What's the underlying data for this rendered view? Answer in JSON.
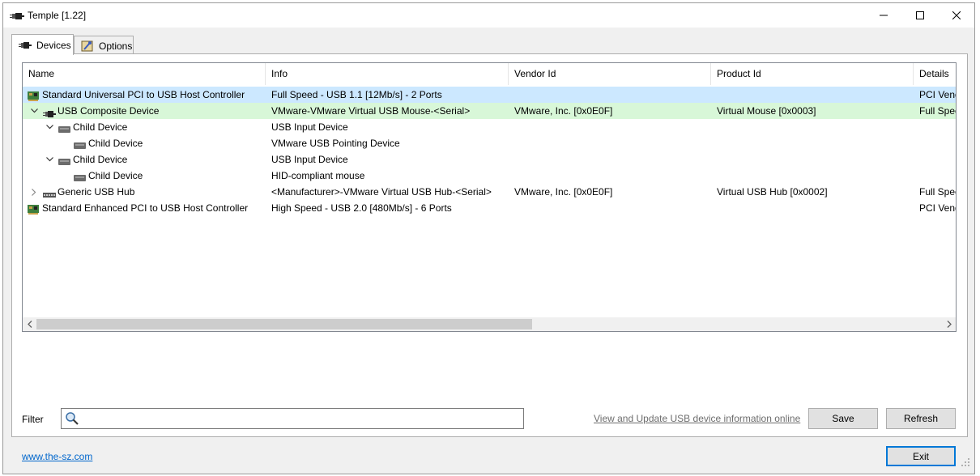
{
  "window": {
    "title": "Temple [1.22]"
  },
  "tabs": [
    {
      "label": "Devices",
      "icon": "usb-plug-icon",
      "active": true
    },
    {
      "label": "Options",
      "icon": "options-icon",
      "active": false
    }
  ],
  "columns": [
    "Name",
    "Info",
    "Vendor Id",
    "Product Id",
    "Details"
  ],
  "rows": [
    {
      "name": "Standard Universal PCI to USB Host Controller",
      "info": "Full Speed - USB 1.1 [12Mb/s] - 2 Ports",
      "vendor": "",
      "product": "",
      "details": "PCI Vendor",
      "level": 0,
      "expander": "none",
      "icon": "pci-card-icon",
      "highlight": "selected"
    },
    {
      "name": "USB Composite Device",
      "info": "VMware-VMware Virtual USB Mouse-<Serial>",
      "vendor": "VMware, Inc. [0x0E0F]",
      "product": "Virtual Mouse [0x0003]",
      "details": "Full Speed",
      "level": 1,
      "expander": "expanded",
      "icon": "usb-plug-icon",
      "highlight": "green"
    },
    {
      "name": "Child Device",
      "info": "USB Input Device",
      "vendor": "",
      "product": "",
      "details": "",
      "level": 2,
      "expander": "expanded",
      "icon": "device-icon",
      "highlight": ""
    },
    {
      "name": "Child Device",
      "info": "VMware USB Pointing Device",
      "vendor": "",
      "product": "",
      "details": "",
      "level": 3,
      "expander": "none",
      "icon": "device-icon",
      "highlight": ""
    },
    {
      "name": "Child Device",
      "info": "USB Input Device",
      "vendor": "",
      "product": "",
      "details": "",
      "level": 2,
      "expander": "expanded",
      "icon": "device-icon",
      "highlight": ""
    },
    {
      "name": "Child Device",
      "info": "HID-compliant mouse",
      "vendor": "",
      "product": "",
      "details": "",
      "level": 3,
      "expander": "none",
      "icon": "device-icon",
      "highlight": ""
    },
    {
      "name": "Generic USB Hub",
      "info": "<Manufacturer>-VMware Virtual USB Hub-<Serial>",
      "vendor": "VMware, Inc. [0x0E0F]",
      "product": "Virtual USB Hub [0x0002]",
      "details": "Full Speed",
      "level": 1,
      "expander": "collapsed",
      "icon": "usb-hub-icon",
      "highlight": ""
    },
    {
      "name": "Standard Enhanced PCI to USB Host Controller",
      "info": "High Speed - USB 2.0 [480Mb/s] - 6 Ports",
      "vendor": "",
      "product": "",
      "details": "PCI Vendor",
      "level": 0,
      "expander": "none",
      "icon": "pci-card-icon",
      "highlight": ""
    }
  ],
  "filter": {
    "label": "Filter",
    "value": "",
    "placeholder": ""
  },
  "online_link": "View and Update USB device information online",
  "buttons": {
    "save": "Save",
    "refresh": "Refresh",
    "exit": "Exit"
  },
  "site_link": "www.the-sz.com",
  "colors": {
    "selected_row": "#cce8ff",
    "green_row": "#d8f7d8",
    "accent": "#0078d7"
  }
}
